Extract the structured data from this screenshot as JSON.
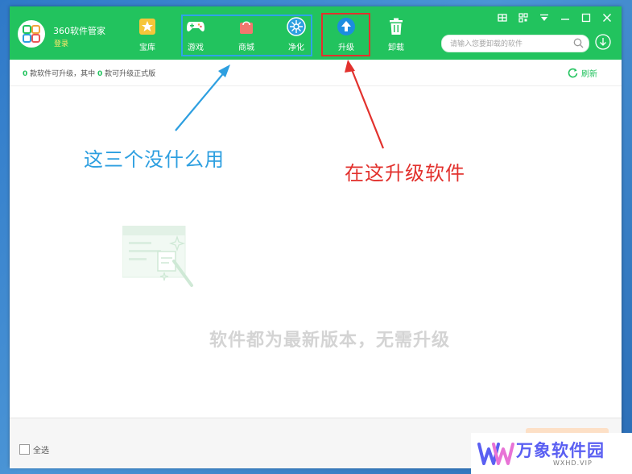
{
  "app": {
    "name": "360软件管家",
    "login": "登录"
  },
  "nav": [
    {
      "label": "宝库",
      "icon": "star-icon"
    },
    {
      "label": "游戏",
      "icon": "gamepad-icon"
    },
    {
      "label": "商城",
      "icon": "shopping-bag-icon"
    },
    {
      "label": "净化",
      "icon": "purify-icon"
    },
    {
      "label": "升级",
      "icon": "upgrade-arrow-icon"
    },
    {
      "label": "卸载",
      "icon": "trash-icon"
    }
  ],
  "search": {
    "placeholder": "请输入您要卸载的软件"
  },
  "status": {
    "count_a": "0",
    "text_a": " 款软件可升级，其中 ",
    "count_b": "0",
    "text_b": " 款可升级正式版",
    "refresh": "刷新"
  },
  "empty_message": "软件都为最新版本，无需升级",
  "annotations": {
    "blue": "这三个没什么用",
    "red": "在这升级软件"
  },
  "footer": {
    "select_all": "全选"
  },
  "watermark": {
    "text": "万象软件园",
    "url": "WXHD.VIP"
  },
  "colors": {
    "brand_green": "#22c35e",
    "annotation_blue": "#2d9fe0",
    "annotation_red": "#e2312d",
    "upgrade_tab_blue": "#1c8de0"
  }
}
